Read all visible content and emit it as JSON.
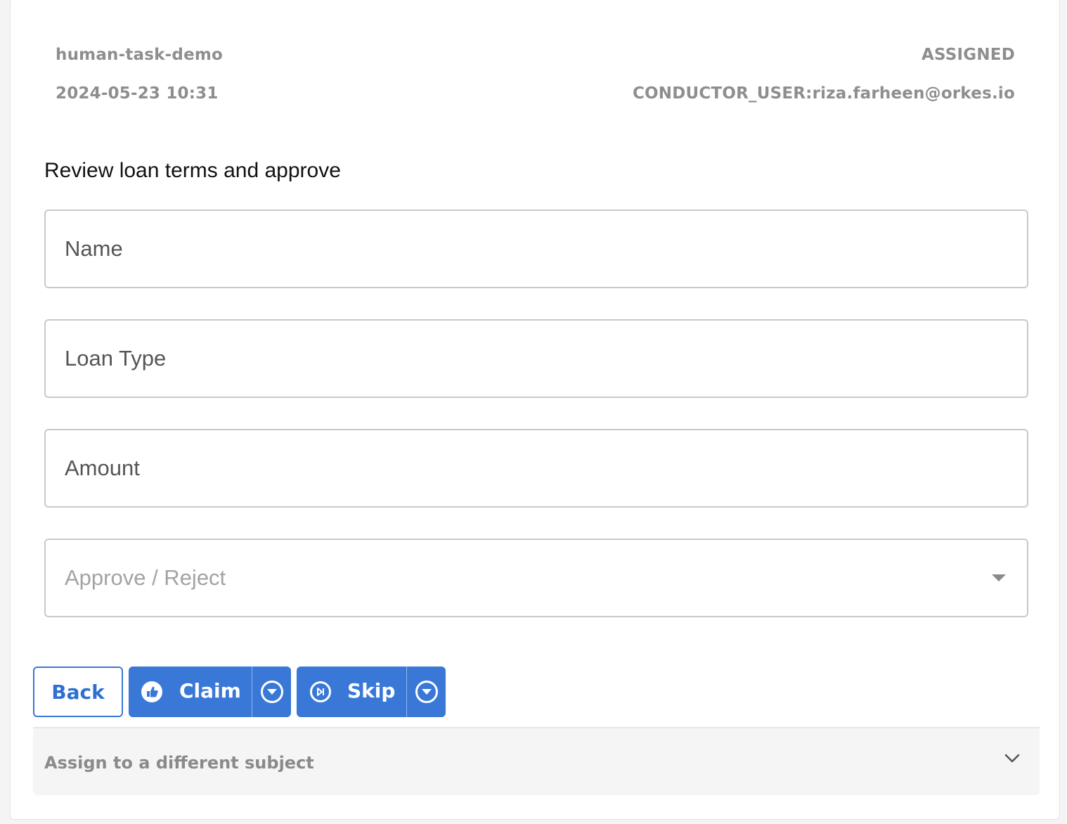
{
  "task": {
    "workflow_name": "human-task-demo",
    "created_at": "2024-05-23 10:31",
    "status": "ASSIGNED",
    "assignee": "CONDUCTOR_USER:riza.farheen@orkes.io"
  },
  "form": {
    "title": "Review loan terms and approve",
    "name_field": {
      "placeholder": "Name",
      "value": ""
    },
    "loan_type_field": {
      "placeholder": "Loan Type",
      "value": ""
    },
    "amount_field": {
      "placeholder": "Amount",
      "value": ""
    },
    "decision_select": {
      "placeholder": "Approve / Reject"
    }
  },
  "actions": {
    "back_label": "Back",
    "claim_label": "Claim",
    "skip_label": "Skip"
  },
  "assign_section": {
    "label": "Assign to a different subject"
  },
  "colors": {
    "primary": "#3a78d8",
    "meta_text": "#8e8e8e",
    "border": "#c9c9c9",
    "accordion_bg": "#f5f5f5"
  },
  "icons": {
    "claim": "thumbs-up-icon",
    "skip": "skip-forward-icon",
    "dropdown": "caret-down-circle-icon",
    "accordion": "chevron-down-icon"
  }
}
